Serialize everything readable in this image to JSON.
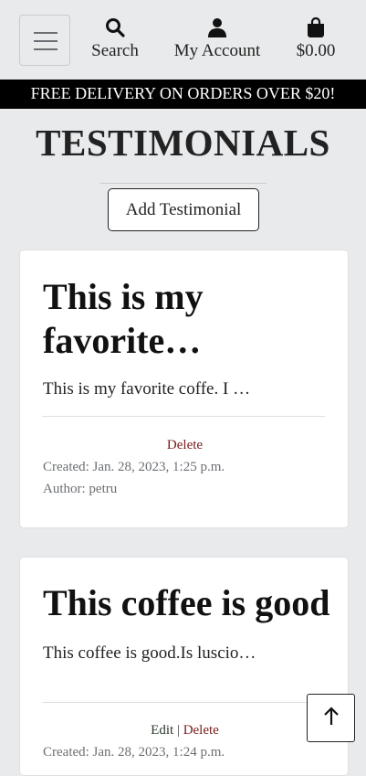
{
  "nav": {
    "search_label": "Search",
    "account_label": "My Account",
    "bag_total": "$0.00",
    "menu_icon": "hamburger-icon",
    "search_icon": "search-icon",
    "account_icon": "user-icon",
    "bag_icon": "shopping-bag-icon"
  },
  "promo": {
    "text": "FREE DELIVERY ON ORDERS OVER $20!"
  },
  "page": {
    "title": "TESTIMONIALS",
    "add_button": "Add Testimonial"
  },
  "testimonials": [
    {
      "title": "This is my favorite…",
      "body": "This is my favorite coffe. I …",
      "delete_label": "Delete",
      "created": "Created: Jan. 28, 2023, 1:25 p.m.",
      "author": "Author: petru"
    },
    {
      "title": "This coffee is good",
      "body": "This coffee is good.Is luscio…",
      "edit_label": "Edit",
      "separator": "|",
      "delete_label": "Delete",
      "created": "Created: Jan. 28, 2023, 1:24 p.m."
    }
  ],
  "back_to_top_icon": "arrow-up-icon",
  "colors": {
    "background": "#e9eaec",
    "promo_bar": "#000000",
    "delete_link": "#7a1a1a",
    "meta_text": "#6b6f73"
  }
}
